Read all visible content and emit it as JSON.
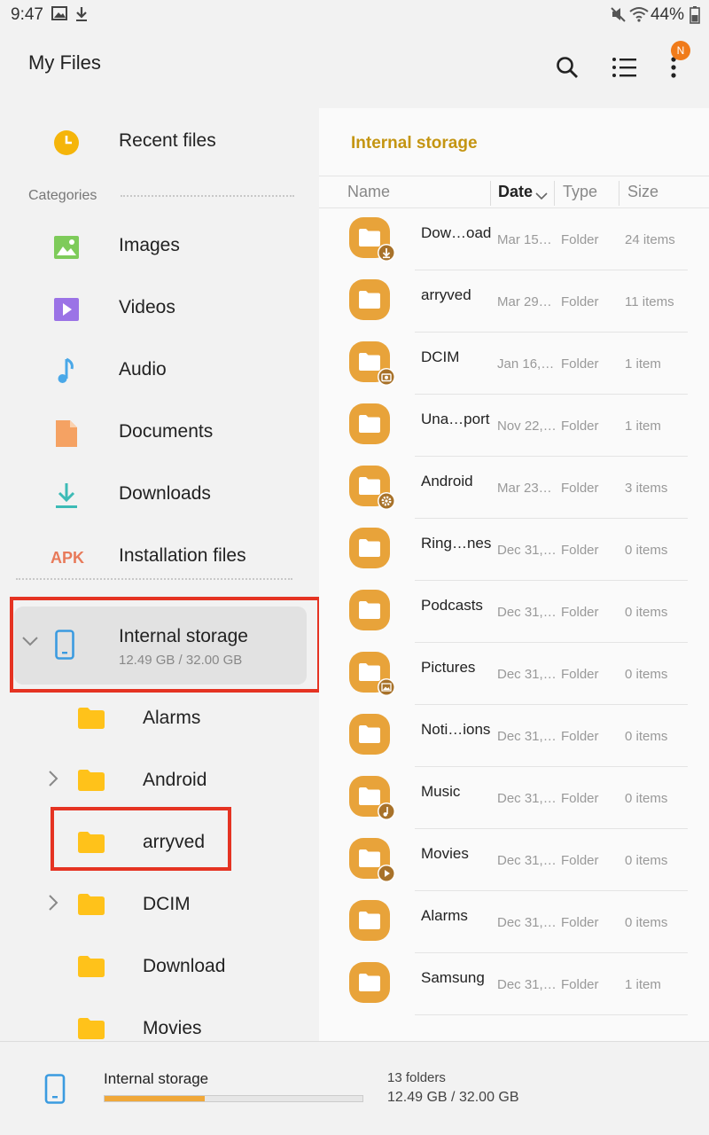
{
  "status": {
    "time": "9:47",
    "battery": "44%"
  },
  "header": {
    "title": "My Files",
    "badge": "N"
  },
  "sidebar": {
    "recent": "Recent files",
    "categories_header": "Categories",
    "categories": [
      "Images",
      "Videos",
      "Audio",
      "Documents",
      "Downloads",
      "Installation files"
    ],
    "apk_label": "APK",
    "storage": {
      "label": "Internal storage",
      "usage": "12.49 GB / 32.00 GB"
    },
    "tree": [
      "Alarms",
      "Android",
      "arryved",
      "DCIM",
      "Download",
      "Movies"
    ]
  },
  "main": {
    "path": "Internal storage",
    "columns": {
      "name": "Name",
      "date": "Date",
      "type": "Type",
      "size": "Size"
    },
    "rows": [
      {
        "name": "Dow…oad",
        "date": "Mar 15…",
        "type": "Folder",
        "size": "24 items",
        "badge": "download-badge"
      },
      {
        "name": "arryved",
        "date": "Mar 29…",
        "type": "Folder",
        "size": "11 items",
        "badge": ""
      },
      {
        "name": "DCIM",
        "date": "Jan 16,…",
        "type": "Folder",
        "size": "1 item",
        "badge": "camera-badge"
      },
      {
        "name": "Una…port",
        "date": "Nov 22,…",
        "type": "Folder",
        "size": "1 item",
        "badge": ""
      },
      {
        "name": "Android",
        "date": "Mar 23…",
        "type": "Folder",
        "size": "3 items",
        "badge": "gear-badge"
      },
      {
        "name": "Ring…nes",
        "date": "Dec 31,…",
        "type": "Folder",
        "size": "0 items",
        "badge": ""
      },
      {
        "name": "Podcasts",
        "date": "Dec 31,…",
        "type": "Folder",
        "size": "0 items",
        "badge": ""
      },
      {
        "name": "Pictures",
        "date": "Dec 31,…",
        "type": "Folder",
        "size": "0 items",
        "badge": "image-badge"
      },
      {
        "name": "Noti…ions",
        "date": "Dec 31,…",
        "type": "Folder",
        "size": "0 items",
        "badge": ""
      },
      {
        "name": "Music",
        "date": "Dec 31,…",
        "type": "Folder",
        "size": "0 items",
        "badge": "music-badge"
      },
      {
        "name": "Movies",
        "date": "Dec 31,…",
        "type": "Folder",
        "size": "0 items",
        "badge": "play-badge"
      },
      {
        "name": "Alarms",
        "date": "Dec 31,…",
        "type": "Folder",
        "size": "0 items",
        "badge": ""
      },
      {
        "name": "Samsung",
        "date": "Dec 31,…",
        "type": "Folder",
        "size": "1 item",
        "badge": ""
      }
    ]
  },
  "footer": {
    "label": "Internal storage",
    "folders": "13 folders",
    "usage": "12.49 GB / 32.00 GB",
    "used_fraction": 0.39
  },
  "colors": {
    "accent": "#e8a33a",
    "folder_yellow": "#ffc21a",
    "highlight": "#e53322",
    "path": "#c49512"
  }
}
